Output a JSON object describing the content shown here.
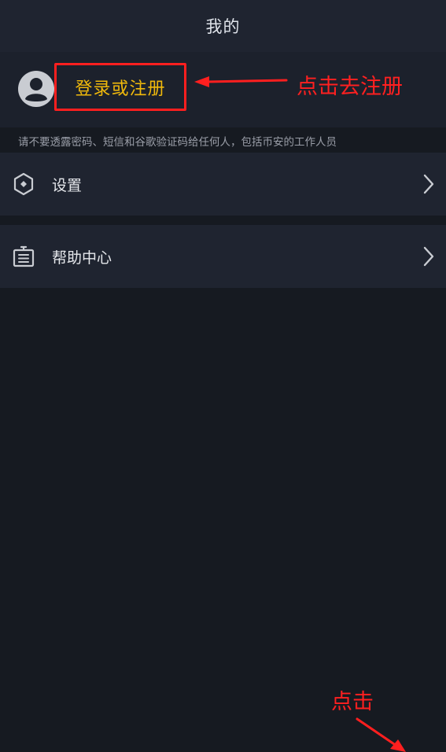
{
  "header": {
    "title": "我的"
  },
  "profile": {
    "avatar_icon": "user-avatar-icon",
    "login_label": "登录或注册"
  },
  "warning": "请不要透露密码、短信和谷歌验证码给任何人，包括币安的工作人员",
  "menu": {
    "items": [
      {
        "label": "设置",
        "icon": "hexagon-settings-icon"
      },
      {
        "label": "帮助中心",
        "icon": "help-document-icon"
      }
    ]
  },
  "annotations": {
    "register_hint": "点击去注册",
    "click_hint": "点击"
  },
  "colors": {
    "accent": "#f0b90b",
    "annotation": "#ff1f1f",
    "background": "#161a21",
    "panel": "#1f2430"
  }
}
